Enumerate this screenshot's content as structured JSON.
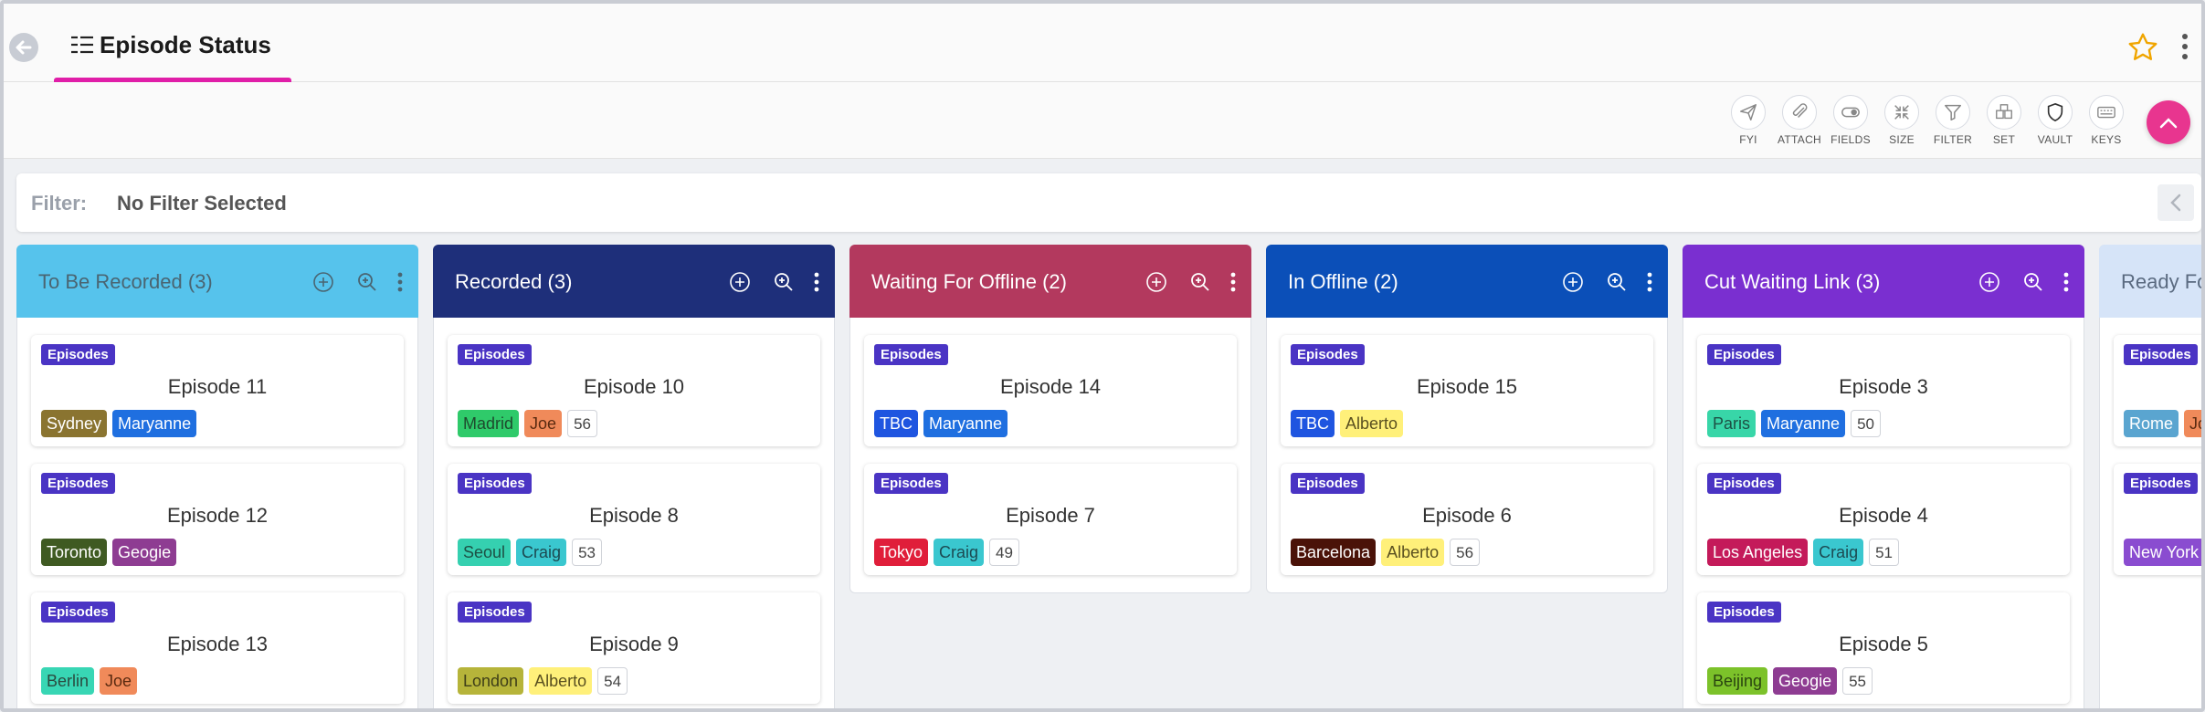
{
  "header": {
    "title": "Episode Status"
  },
  "toolbar": {
    "tools": [
      {
        "label": "FYI",
        "icon": "send-icon"
      },
      {
        "label": "ATTACH",
        "icon": "paperclip-icon"
      },
      {
        "label": "FIELDS",
        "icon": "toggle-icon"
      },
      {
        "label": "SIZE",
        "icon": "compress-icon"
      },
      {
        "label": "FILTER",
        "icon": "filter-icon"
      },
      {
        "label": "SET",
        "icon": "boxes-icon"
      },
      {
        "label": "VAULT",
        "icon": "shield-icon"
      },
      {
        "label": "KEYS",
        "icon": "keyboard-icon"
      }
    ]
  },
  "filter": {
    "label": "Filter:",
    "value": "No Filter Selected"
  },
  "colors": {
    "accent": "#e01ea8",
    "episodes_tag": "#4a34c4"
  },
  "columns": [
    {
      "title": "To Be Recorded (3)",
      "color": "#56c3ec",
      "text_color": "#4a6572",
      "cards": [
        {
          "type": "Episodes",
          "title": "Episode 11",
          "chips": [
            {
              "text": "Sydney",
              "bg": "#8a7430",
              "fg": "#ffffff"
            },
            {
              "text": "Maryanne",
              "bg": "#1f6fe0",
              "fg": "#ffffff"
            }
          ]
        },
        {
          "type": "Episodes",
          "title": "Episode 12",
          "chips": [
            {
              "text": "Toronto",
              "bg": "#3f5a22",
              "fg": "#ffffff"
            },
            {
              "text": "Geogie",
              "bg": "#8e3c92",
              "fg": "#ffffff"
            }
          ]
        },
        {
          "type": "Episodes",
          "title": "Episode 13",
          "chips": [
            {
              "text": "Berlin",
              "bg": "#38d6b4",
              "fg": "#2a4a3f"
            },
            {
              "text": "Joe",
              "bg": "#f08a5a",
              "fg": "#5a2a10"
            }
          ]
        }
      ]
    },
    {
      "title": "Recorded (3)",
      "color": "#1e2f7a",
      "text_color": "#ffffff",
      "cards": [
        {
          "type": "Episodes",
          "title": "Episode 10",
          "chips": [
            {
              "text": "Madrid",
              "bg": "#2fca6a",
              "fg": "#1e4a2e"
            },
            {
              "text": "Joe",
              "bg": "#f08a5a",
              "fg": "#5a2a10"
            },
            {
              "text": "56",
              "num": true
            }
          ]
        },
        {
          "type": "Episodes",
          "title": "Episode 8",
          "chips": [
            {
              "text": "Seoul",
              "bg": "#35d0b0",
              "fg": "#1d5044"
            },
            {
              "text": "Craig",
              "bg": "#3ac7cf",
              "fg": "#1c4a52"
            },
            {
              "text": "53",
              "num": true
            }
          ]
        },
        {
          "type": "Episodes",
          "title": "Episode 9",
          "chips": [
            {
              "text": "London",
              "bg": "#b6b43a",
              "fg": "#3e3e18"
            },
            {
              "text": "Alberto",
              "bg": "#fff07a",
              "fg": "#5a5020"
            },
            {
              "text": "54",
              "num": true
            }
          ]
        }
      ]
    },
    {
      "title": "Waiting For Offline (2)",
      "color": "#b3395e",
      "text_color": "#ffffff",
      "cards": [
        {
          "type": "Episodes",
          "title": "Episode 14",
          "chips": [
            {
              "text": "TBC",
              "bg": "#1f55e0",
              "fg": "#ffffff"
            },
            {
              "text": "Maryanne",
              "bg": "#1f6fe0",
              "fg": "#ffffff"
            }
          ]
        },
        {
          "type": "Episodes",
          "title": "Episode 7",
          "chips": [
            {
              "text": "Tokyo",
              "bg": "#e01e3a",
              "fg": "#ffffff"
            },
            {
              "text": "Craig",
              "bg": "#3ac7cf",
              "fg": "#1c4a52"
            },
            {
              "text": "49",
              "num": true
            }
          ]
        }
      ]
    },
    {
      "title": "In Offline (2)",
      "color": "#0b4fb8",
      "text_color": "#ffffff",
      "cards": [
        {
          "type": "Episodes",
          "title": "Episode 15",
          "chips": [
            {
              "text": "TBC",
              "bg": "#1f55e0",
              "fg": "#ffffff"
            },
            {
              "text": "Alberto",
              "bg": "#fff07a",
              "fg": "#5a5020"
            }
          ]
        },
        {
          "type": "Episodes",
          "title": "Episode 6",
          "chips": [
            {
              "text": "Barcelona",
              "bg": "#4a1208",
              "fg": "#ffffff"
            },
            {
              "text": "Alberto",
              "bg": "#fff07a",
              "fg": "#5a5020"
            },
            {
              "text": "56",
              "num": true
            }
          ]
        }
      ]
    },
    {
      "title": "Cut Waiting Link (3)",
      "color": "#7a2fd0",
      "text_color": "#ffffff",
      "cards": [
        {
          "type": "Episodes",
          "title": "Episode 3",
          "chips": [
            {
              "text": "Paris",
              "bg": "#38d6a8",
              "fg": "#1d5044"
            },
            {
              "text": "Maryanne",
              "bg": "#1f6fe0",
              "fg": "#ffffff"
            },
            {
              "text": "50",
              "num": true
            }
          ]
        },
        {
          "type": "Episodes",
          "title": "Episode 4",
          "chips": [
            {
              "text": "Los Angeles",
              "bg": "#c41a5a",
              "fg": "#ffffff"
            },
            {
              "text": "Craig",
              "bg": "#3ac7cf",
              "fg": "#1c4a52"
            },
            {
              "text": "51",
              "num": true
            }
          ]
        },
        {
          "type": "Episodes",
          "title": "Episode 5",
          "chips": [
            {
              "text": "Beijing",
              "bg": "#7cc22a",
              "fg": "#2a4510"
            },
            {
              "text": "Geogie",
              "bg": "#8e3c92",
              "fg": "#ffffff"
            },
            {
              "text": "55",
              "num": true
            }
          ]
        }
      ]
    },
    {
      "title": "Ready Fo",
      "color": "#d6e4f8",
      "text_color": "#5a6a80",
      "cards": [
        {
          "type": "Episodes",
          "title": "",
          "chips": [
            {
              "text": "Rome",
              "bg": "#5aa5d0",
              "fg": "#ffffff"
            },
            {
              "text": "Jo",
              "bg": "#f08a5a",
              "fg": "#5a2a10"
            }
          ]
        },
        {
          "type": "Episodes",
          "title": "",
          "chips": [
            {
              "text": "New York",
              "bg": "#8a4cd0",
              "fg": "#ffffff"
            }
          ]
        }
      ]
    }
  ]
}
